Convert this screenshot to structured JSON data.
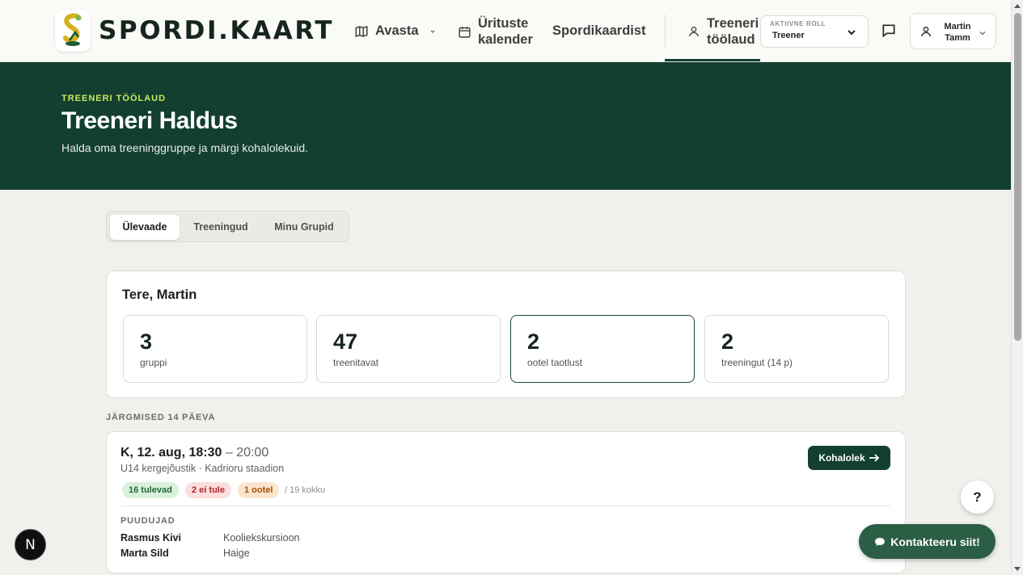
{
  "header": {
    "logo_text": "SPORDI.KAART",
    "nav": {
      "explore": "Avasta",
      "calendar_line1": "Ürituste",
      "calendar_line2": "kalender",
      "directory": "Spordikaardist",
      "dashboard_line1": "Treeneri",
      "dashboard_line2": "töölaud"
    },
    "role": {
      "label": "AKTIIVNE ROLL",
      "value": "Treener"
    },
    "user": {
      "first": "Martin",
      "last": "Tamm"
    }
  },
  "hero": {
    "eyebrow": "TREENERI TÖÖLAUD",
    "title": "Treeneri Haldus",
    "subtitle": "Halda oma treeninggruppe ja märgi kohalolekuid."
  },
  "tabs": [
    {
      "label": "Ülevaade"
    },
    {
      "label": "Treeningud"
    },
    {
      "label": "Minu Grupid"
    }
  ],
  "summary": {
    "greeting": "Tere, Martin",
    "stats": [
      {
        "value": "3",
        "label": "gruppi"
      },
      {
        "value": "47",
        "label": "treenitavat"
      },
      {
        "value": "2",
        "label": "ootel taotlust"
      },
      {
        "value": "2",
        "label": "treeningut (14 p)"
      }
    ]
  },
  "upcoming": {
    "section_label": "JÄRGMISED 14 PÄEVA",
    "session": {
      "date_bold": "K, 12. aug, 18:30",
      "date_end": " – 20:00",
      "meta": "U14 kergejõustik · Kadrioru staadion",
      "pill_coming": "16 tulevad",
      "pill_not": "2 ei tule",
      "pill_pending": "1 ootel",
      "total": "/ 19 kokku",
      "attendance_button": "Kohalolek",
      "absent_title": "PUUDUJAD",
      "absent": [
        {
          "name": "Rasmus Kivi",
          "reason": "Kooliekskursioon"
        },
        {
          "name": "Marta Sild",
          "reason": "Haige"
        }
      ]
    }
  },
  "floating": {
    "help": "?",
    "contact": "Kontakteeru siit!",
    "badge": "N"
  },
  "colors": {
    "brand_dark": "#133f31",
    "accent_lime": "#c7ea5b",
    "contact_green": "#2c5d45"
  }
}
